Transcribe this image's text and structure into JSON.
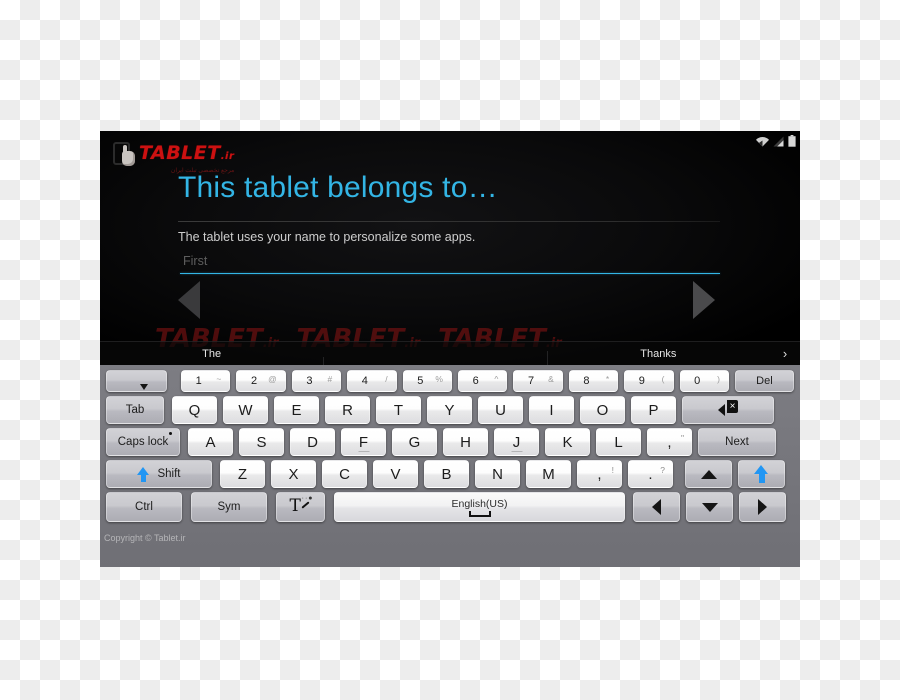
{
  "screen": {
    "statusbar": {
      "wifi_icon": "wifi-icon",
      "signal_icon": "cellular-signal-icon",
      "battery_icon": "battery-icon"
    },
    "brand": {
      "wordmark": "TABLET",
      "tld": ".ir",
      "subtitle": "مرجع تخصصی تبلت ایران",
      "watermark": "TABLET",
      "watermark_tld": ".ir"
    },
    "headline": "This tablet belongs to…",
    "subtitle": "The tablet uses your name to personalize some apps.",
    "field": {
      "value": "",
      "placeholder": "First"
    },
    "nav": {
      "prev_icon": "previous-triangle-icon",
      "next_icon": "next-triangle-icon"
    },
    "suggestions": {
      "items": [
        "The",
        "",
        "Thanks"
      ],
      "more_icon": "›"
    }
  },
  "keyboard": {
    "copyright": "Copyright © Tablet.ir",
    "row1": {
      "hide_keyboard_icon": "hide-keyboard-icon",
      "numbers": [
        {
          "n": "1",
          "alt": "~"
        },
        {
          "n": "2",
          "alt": "@"
        },
        {
          "n": "3",
          "alt": "#"
        },
        {
          "n": "4",
          "alt": "/"
        },
        {
          "n": "5",
          "alt": "%"
        },
        {
          "n": "6",
          "alt": "^"
        },
        {
          "n": "7",
          "alt": "&"
        },
        {
          "n": "8",
          "alt": "*"
        },
        {
          "n": "9",
          "alt": "("
        },
        {
          "n": "0",
          "alt": ")"
        }
      ],
      "del": "Del"
    },
    "row2": {
      "tab": "Tab",
      "letters": [
        "Q",
        "W",
        "E",
        "R",
        "T",
        "Y",
        "U",
        "I",
        "O",
        "P"
      ],
      "backspace_icon": "backspace-icon"
    },
    "row3": {
      "caps": "Caps lock",
      "letters": [
        "A",
        "S",
        "D",
        "F",
        "G",
        "H",
        "J",
        "K",
        "L"
      ],
      "comma_key": {
        "main": ",",
        "alt": "\""
      },
      "next": "Next"
    },
    "row4": {
      "shift": "Shift",
      "letters": [
        "Z",
        "X",
        "C",
        "V",
        "B",
        "N",
        "M"
      ],
      "comma_key": {
        "main": ",",
        "alt": "!"
      },
      "period_key": {
        "main": ".",
        "alt": "?"
      },
      "up_icon": "arrow-up-icon",
      "shift_right_icon": "shift-arrow-icon"
    },
    "row5": {
      "ctrl": "Ctrl",
      "sym": "Sym",
      "ime_icon": "input-method-icon",
      "space_label": "English(US)",
      "left_icon": "arrow-left-icon",
      "down_icon": "arrow-down-icon",
      "right_icon": "arrow-right-icon"
    }
  }
}
